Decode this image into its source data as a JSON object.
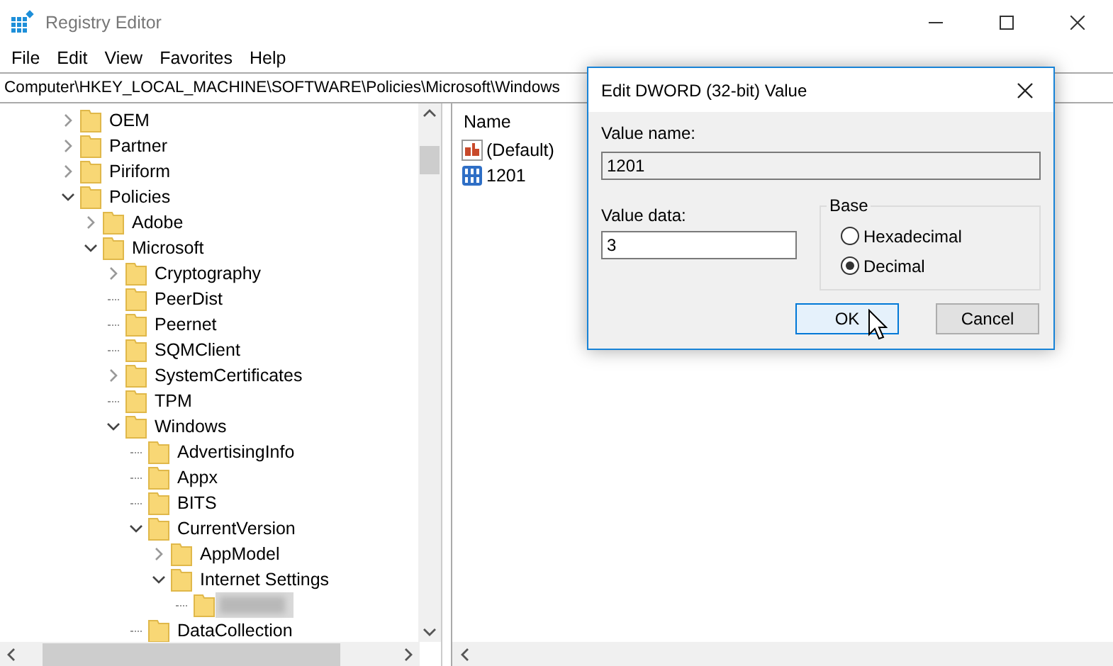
{
  "window": {
    "title": "Registry Editor"
  },
  "menu": [
    "File",
    "Edit",
    "View",
    "Favorites",
    "Help"
  ],
  "address": "Computer\\HKEY_LOCAL_MACHINE\\SOFTWARE\\Policies\\Microsoft\\Windows",
  "tree": [
    {
      "label": "OEM",
      "kind": "branch",
      "expanded": false,
      "selected": false
    },
    {
      "label": "Partner",
      "kind": "branch",
      "expanded": false,
      "selected": false
    },
    {
      "label": "Piriform",
      "kind": "branch",
      "expanded": false,
      "selected": false
    },
    {
      "label": "Policies",
      "kind": "branch",
      "expanded": true,
      "selected": false,
      "children": [
        {
          "label": "Adobe",
          "kind": "branch",
          "expanded": false,
          "selected": false
        },
        {
          "label": "Microsoft",
          "kind": "branch",
          "expanded": true,
          "selected": false,
          "children": [
            {
              "label": "Cryptography",
              "kind": "branch",
              "expanded": false,
              "selected": false
            },
            {
              "label": "PeerDist",
              "kind": "leaf",
              "selected": false
            },
            {
              "label": "Peernet",
              "kind": "leaf",
              "selected": false
            },
            {
              "label": "SQMClient",
              "kind": "leaf",
              "selected": false
            },
            {
              "label": "SystemCertificates",
              "kind": "branch",
              "expanded": false,
              "selected": false
            },
            {
              "label": "TPM",
              "kind": "leaf",
              "selected": false
            },
            {
              "label": "Windows",
              "kind": "branch",
              "expanded": true,
              "selected": false,
              "children": [
                {
                  "label": "AdvertisingInfo",
                  "kind": "leaf",
                  "selected": false
                },
                {
                  "label": "Appx",
                  "kind": "leaf",
                  "selected": false
                },
                {
                  "label": "BITS",
                  "kind": "leaf",
                  "selected": false
                },
                {
                  "label": "CurrentVersion",
                  "kind": "branch",
                  "expanded": true,
                  "selected": false,
                  "children": [
                    {
                      "label": "AppModel",
                      "kind": "branch",
                      "expanded": false,
                      "selected": false
                    },
                    {
                      "label": "Internet Settings",
                      "kind": "branch",
                      "expanded": true,
                      "selected": false,
                      "children": [
                        {
                          "kind": "leaf",
                          "selected": true
                        }
                      ]
                    }
                  ]
                },
                {
                  "label": "DataCollection",
                  "kind": "leaf",
                  "selected": false
                }
              ]
            }
          ]
        }
      ]
    }
  ],
  "values": {
    "columns": [
      "Name"
    ],
    "rows": [
      {
        "kind": "string",
        "name": "(Default)"
      },
      {
        "kind": "dword",
        "name": "1201"
      }
    ]
  },
  "dialog": {
    "title": "Edit DWORD (32-bit) Value",
    "name_label": "Value name:",
    "name_value": "1201",
    "data_label": "Value data:",
    "data_value": "3",
    "base_label": "Base",
    "base_options": [
      {
        "label": "Hexadecimal",
        "selected": false
      },
      {
        "label": "Decimal",
        "selected": true
      }
    ],
    "buttons": [
      {
        "label": "OK",
        "focused": true
      },
      {
        "label": "Cancel",
        "focused": false
      }
    ]
  }
}
